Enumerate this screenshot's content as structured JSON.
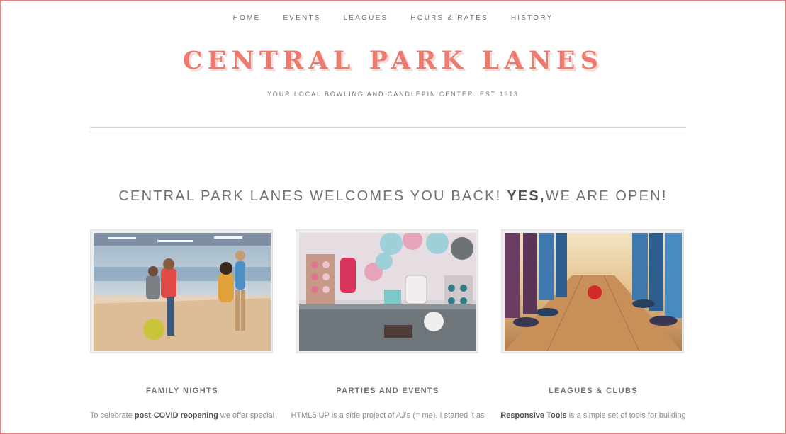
{
  "nav": {
    "items": [
      {
        "label": "HOME"
      },
      {
        "label": "EVENTS"
      },
      {
        "label": "LEAGUES"
      },
      {
        "label": "HOURS & RATES"
      },
      {
        "label": "HISTORY"
      }
    ]
  },
  "header": {
    "logo": "CENTRAL PARK LANES",
    "tagline": "YOUR LOCAL BOWLING AND CANDLEPIN CENTER. EST 1913"
  },
  "headline": {
    "text_start": "CENTRAL PARK LANES WELCOMES YOU BACK! ",
    "text_bold": "YES,",
    "text_end": "WE ARE OPEN!"
  },
  "cards": [
    {
      "title": "FAMILY NIGHTS",
      "text_start": "To celebrate ",
      "text_bold": "post-COVID reopening",
      "text_end": " we offer special"
    },
    {
      "title": "PARTIES AND EVENTS",
      "text_start": "HTML5 UP is a side project of AJ's (= me). I started it as",
      "text_bold": "",
      "text_end": ""
    },
    {
      "title": "LEAGUES & CLUBS",
      "text_start": "",
      "text_bold": "Responsive Tools",
      "text_end": " is a simple set of tools for building"
    }
  ],
  "colors": {
    "accent": "#ee7a6e",
    "frame": "#e5867c",
    "text": "#6d7173"
  }
}
